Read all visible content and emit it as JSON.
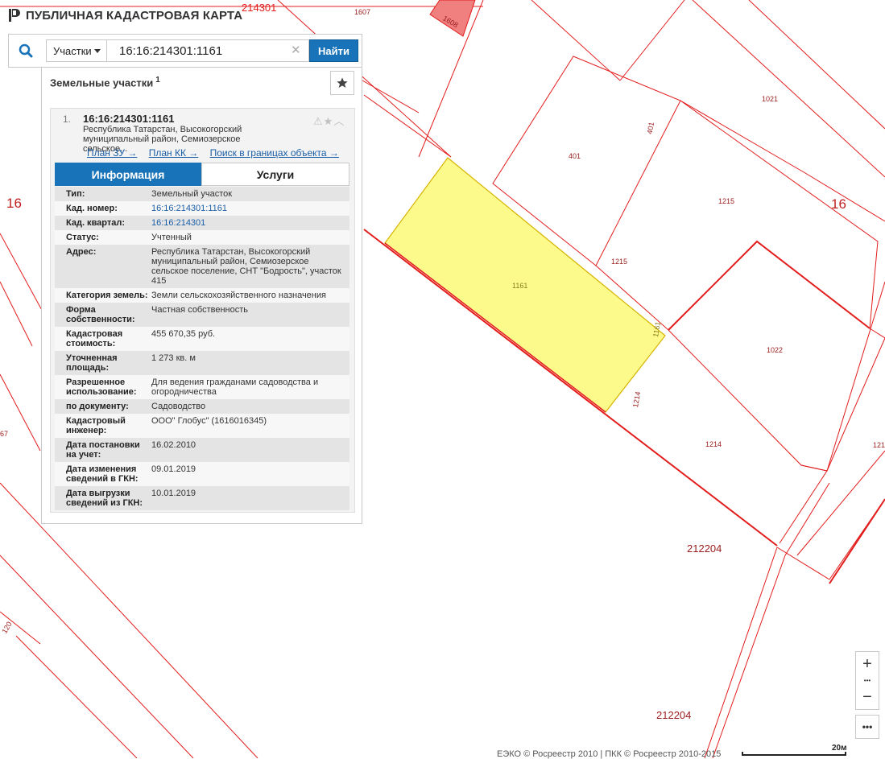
{
  "app": {
    "title": "ПУБЛИЧНАЯ КАДАСТРОВАЯ КАРТА"
  },
  "search": {
    "type_label": "Участки",
    "query": "16:16:214301:1161",
    "clear_glyph": "✕",
    "find_label": "Найти"
  },
  "results": {
    "heading": "Земельные участки",
    "count": "1",
    "item": {
      "index": "1.",
      "cadastral_id": "16:16:214301:1161",
      "address_line1": "Республика Татарстан, Высокогорский",
      "address_line2": "муниципальный район, Семиозерское сельское...",
      "links": [
        "План ЗУ →",
        "План КК →",
        "Поиск в границах объекта →"
      ],
      "tabs": [
        "Информация",
        "Услуги"
      ],
      "properties": [
        {
          "key": "Тип:",
          "value": "Земельный участок"
        },
        {
          "key": "Кад. номер:",
          "value": "16:16:214301:1161"
        },
        {
          "key": "Кад. квартал:",
          "value": "16:16:214301"
        },
        {
          "key": "Статус:",
          "value": "Учтенный"
        },
        {
          "key": "Адрес:",
          "value": "Республика Татарстан, Высокогорский муниципальный район, Семиозерское сельское поселение, СНТ \"Бодрость\", участок 415"
        },
        {
          "key": "Категория земель:",
          "value": "Земли сельскохозяйственного назначения"
        },
        {
          "key": "Форма собственности:",
          "value": "Частная собственность"
        },
        {
          "key": "Кадастровая стоимость:",
          "value": "455 670,35 руб."
        },
        {
          "key": "Уточненная площадь:",
          "value": "1 273 кв. м"
        },
        {
          "key": "Разрешенное использование:",
          "value": "Для ведения гражданами садоводства и огородничества"
        },
        {
          "key": "по документу:",
          "value": "Садоводство"
        },
        {
          "key": "Кадастровый инженер:",
          "value": "ООО\" Глобус\" (1616016345)"
        },
        {
          "key": "Дата постановки на учет:",
          "value": "16.02.2010"
        },
        {
          "key": "Дата изменения сведений в ГКН:",
          "value": "09.01.2019"
        },
        {
          "key": "Дата выгрузки сведений из ГКН:",
          "value": "10.01.2019"
        }
      ]
    }
  },
  "map": {
    "labels": [
      "214301",
      "1607",
      "1608",
      "1021",
      "401",
      "401",
      "1215",
      "1215",
      "16",
      "16",
      "1161",
      "1161",
      "1022",
      "1214",
      "1214",
      "212204",
      "212204",
      "67",
      "121",
      "120"
    ],
    "colors": {
      "boundary": "#e31c1c",
      "selected_fill": "#fdfa8c",
      "selected_stroke": "#d6b400",
      "small_parcel_fill": "#f08080",
      "label": "#9a1b1b"
    }
  },
  "zoom": {
    "in": "+",
    "dots": "•••",
    "out": "−"
  },
  "more": "•••",
  "footer": {
    "copyright": "ЕЭКО © Росреестр 2010 | ПКК © Росреестр 2010-2015",
    "scale": "20м"
  }
}
